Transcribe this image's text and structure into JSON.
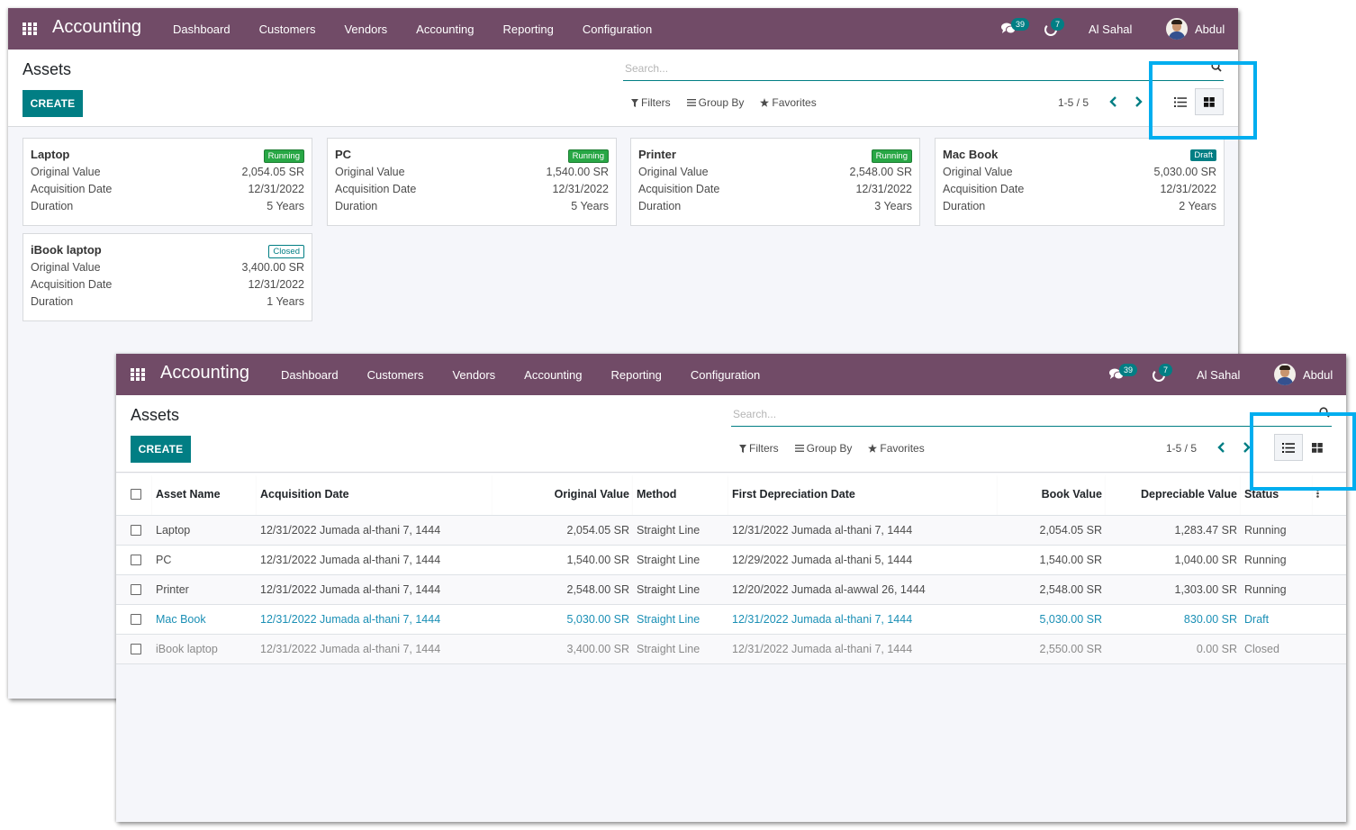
{
  "app": {
    "brand": "Accounting",
    "menu": [
      "Dashboard",
      "Customers",
      "Vendors",
      "Accounting",
      "Reporting",
      "Configuration"
    ],
    "messages_count": "39",
    "activities_count": "7",
    "company": "Al Sahal",
    "user": "Abdul"
  },
  "control_panel": {
    "title": "Assets",
    "create_label": "CREATE",
    "search_placeholder": "Search...",
    "filters_label": "Filters",
    "group_by_label": "Group By",
    "favorites_label": "Favorites",
    "pager": "1-5 / 5"
  },
  "kanban_view": {
    "active_view": "kanban",
    "field_labels": {
      "original_value": "Original Value",
      "acquisition_date": "Acquisition Date",
      "duration": "Duration"
    },
    "cards": [
      {
        "name": "Laptop",
        "status": "Running",
        "original_value": "2,054.05 SR",
        "acquisition_date": "12/31/2022",
        "duration": "5 Years"
      },
      {
        "name": "PC",
        "status": "Running",
        "original_value": "1,540.00 SR",
        "acquisition_date": "12/31/2022",
        "duration": "5 Years"
      },
      {
        "name": "Printer",
        "status": "Running",
        "original_value": "2,548.00 SR",
        "acquisition_date": "12/31/2022",
        "duration": "3 Years"
      },
      {
        "name": "Mac Book",
        "status": "Draft",
        "original_value": "5,030.00 SR",
        "acquisition_date": "12/31/2022",
        "duration": "2 Years"
      },
      {
        "name": "iBook laptop",
        "status": "Closed",
        "original_value": "3,400.00 SR",
        "acquisition_date": "12/31/2022",
        "duration": "1 Years"
      }
    ]
  },
  "list_view": {
    "active_view": "list",
    "columns": [
      "Asset Name",
      "Acquisition Date",
      "Original Value",
      "Method",
      "First Depreciation Date",
      "Book Value",
      "Depreciable Value",
      "Status"
    ],
    "rows": [
      {
        "name": "Laptop",
        "acquisition_date": "12/31/2022 Jumada al-thani 7, 1444",
        "original_value": "2,054.05 SR",
        "method": "Straight Line",
        "first_depreciation_date": "12/31/2022 Jumada al-thani 7, 1444",
        "book_value": "2,054.05 SR",
        "depreciable_value": "1,283.47 SR",
        "status": "Running"
      },
      {
        "name": "PC",
        "acquisition_date": "12/31/2022 Jumada al-thani 7, 1444",
        "original_value": "1,540.00 SR",
        "method": "Straight Line",
        "first_depreciation_date": "12/29/2022 Jumada al-thani 5, 1444",
        "book_value": "1,540.00 SR",
        "depreciable_value": "1,040.00 SR",
        "status": "Running"
      },
      {
        "name": "Printer",
        "acquisition_date": "12/31/2022 Jumada al-thani 7, 1444",
        "original_value": "2,548.00 SR",
        "method": "Straight Line",
        "first_depreciation_date": "12/20/2022 Jumada al-awwal 26, 1444",
        "book_value": "2,548.00 SR",
        "depreciable_value": "1,303.00 SR",
        "status": "Running"
      },
      {
        "name": "Mac Book",
        "acquisition_date": "12/31/2022 Jumada al-thani 7, 1444",
        "original_value": "5,030.00 SR",
        "method": "Straight Line",
        "first_depreciation_date": "12/31/2022 Jumada al-thani 7, 1444",
        "book_value": "5,030.00 SR",
        "depreciable_value": "830.00 SR",
        "status": "Draft"
      },
      {
        "name": "iBook laptop",
        "acquisition_date": "12/31/2022 Jumada al-thani 7, 1444",
        "original_value": "3,400.00 SR",
        "method": "Straight Line",
        "first_depreciation_date": "12/31/2022 Jumada al-thani 7, 1444",
        "book_value": "2,550.00 SR",
        "depreciable_value": "0.00 SR",
        "status": "Closed"
      }
    ]
  },
  "colors": {
    "navbar": "#714b67",
    "primary": "#017e84",
    "running_badge": "#28a745",
    "highlight": "#00aeef",
    "draft_row_text": "#1a8fb5"
  }
}
